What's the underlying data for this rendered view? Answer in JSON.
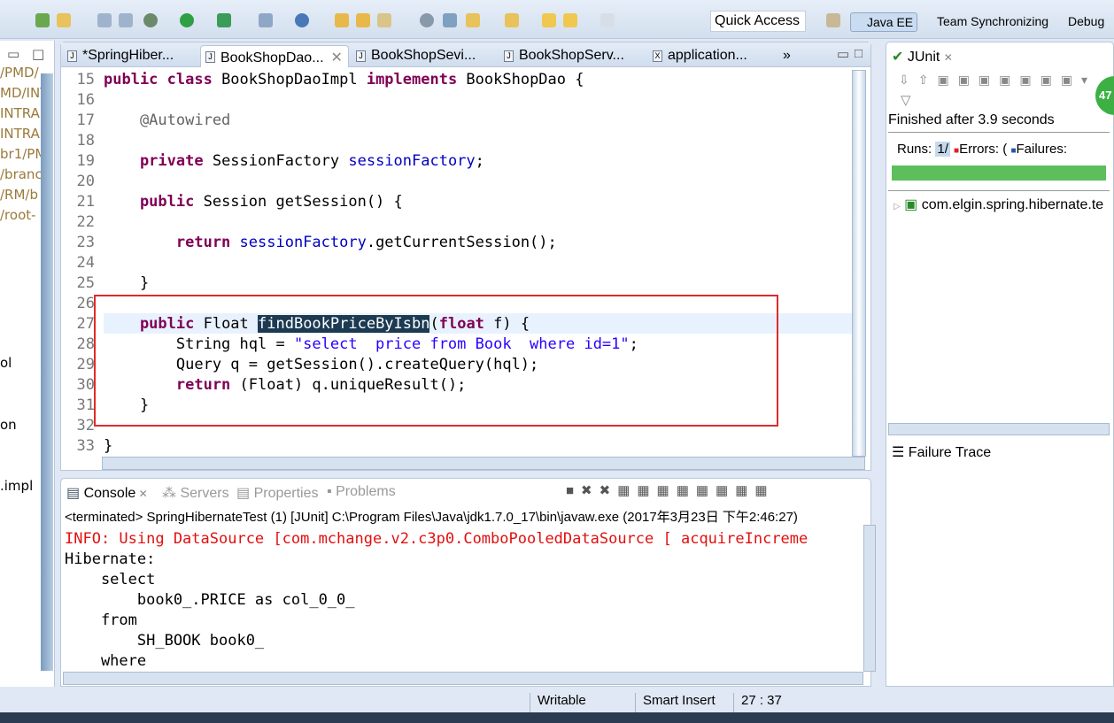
{
  "toolbar": {
    "quick_access": "Quick Access",
    "perspectives": [
      "Java EE",
      "Team Synchronizing",
      "Debug"
    ]
  },
  "left_panel": {
    "fragments": [
      "/PMD/",
      "MD/INT",
      "INTRA",
      "INTRA",
      "br1/PM",
      "/branc",
      "/RM/b",
      "/root-",
      "ol",
      "on",
      ".impl"
    ]
  },
  "editor": {
    "tabs": [
      {
        "label": "*SpringHiber..."
      },
      {
        "label": "BookShopDao...",
        "active": true
      },
      {
        "label": "BookShopSevi..."
      },
      {
        "label": "BookShopServ..."
      },
      {
        "label": "application..."
      }
    ],
    "overflow": "»",
    "lines": [
      {
        "n": "15",
        "t": [
          [
            "public class ",
            "kw"
          ],
          [
            "BookShopDaoImpl ",
            ""
          ],
          [
            "implements ",
            "kw"
          ],
          [
            "BookShopDao {",
            ""
          ]
        ]
      },
      {
        "n": "16",
        "t": []
      },
      {
        "n": "17",
        "t": [
          [
            "    @Autowired",
            "ann"
          ]
        ]
      },
      {
        "n": "18",
        "t": []
      },
      {
        "n": "19",
        "t": [
          [
            "    private ",
            "kw"
          ],
          [
            "SessionFactory ",
            ""
          ],
          [
            "sessionFactory",
            "fld"
          ],
          [
            ";",
            ""
          ]
        ]
      },
      {
        "n": "20",
        "t": []
      },
      {
        "n": "21",
        "t": [
          [
            "    public ",
            "kw"
          ],
          [
            "Session getSession() {",
            ""
          ]
        ]
      },
      {
        "n": "22",
        "t": []
      },
      {
        "n": "23",
        "t": [
          [
            "        return ",
            "kw"
          ],
          [
            "sessionFactory",
            "fld"
          ],
          [
            ".getCurrentSession();",
            ""
          ]
        ]
      },
      {
        "n": "24",
        "t": []
      },
      {
        "n": "25",
        "t": [
          [
            "    }",
            ""
          ]
        ]
      },
      {
        "n": "26",
        "t": []
      },
      {
        "n": "27",
        "t": [
          [
            "    public ",
            "kw"
          ],
          [
            "Float ",
            ""
          ],
          [
            "findBookPriceByIsbn",
            "sel"
          ],
          [
            "(",
            ""
          ],
          [
            "float ",
            "kw"
          ],
          [
            "f) {",
            ""
          ]
        ]
      },
      {
        "n": "28",
        "t": [
          [
            "        String hql = ",
            ""
          ],
          [
            "\"select  price from Book  where id=1\"",
            "str"
          ],
          [
            ";",
            ""
          ]
        ]
      },
      {
        "n": "29",
        "t": [
          [
            "        Query q = getSession().createQuery(hql);",
            ""
          ]
        ]
      },
      {
        "n": "30",
        "t": [
          [
            "        return ",
            "kw"
          ],
          [
            "(Float) q.uniqueResult();",
            ""
          ]
        ]
      },
      {
        "n": "31",
        "t": [
          [
            "    }",
            ""
          ]
        ]
      },
      {
        "n": "32",
        "t": []
      },
      {
        "n": "33",
        "t": [
          [
            "}",
            ""
          ]
        ]
      }
    ]
  },
  "console": {
    "tabs": [
      "Console",
      "Servers",
      "Properties",
      "Problems"
    ],
    "header": "<terminated> SpringHibernateTest (1) [JUnit] C:\\Program Files\\Java\\jdk1.7.0_17\\bin\\javaw.exe (2017年3月23日 下午2:46:27)",
    "lines": [
      {
        "text": "INFO: Using DataSource [com.mchange.v2.c3p0.ComboPooledDataSource [ acquireIncreme",
        "color": "#e01010"
      },
      {
        "text": "Hibernate:",
        "color": "#000000"
      },
      {
        "text": "    select",
        "color": "#000000"
      },
      {
        "text": "        book0_.PRICE as col_0_0_",
        "color": "#000000"
      },
      {
        "text": "    from",
        "color": "#000000"
      },
      {
        "text": "        SH_BOOK book0_",
        "color": "#000000"
      },
      {
        "text": "    where",
        "color": "#000000"
      }
    ]
  },
  "junit": {
    "tab": "JUnit",
    "finished": "Finished after 3.9 seconds",
    "runs_label": "Runs:",
    "runs_value": "1/",
    "errors_label": "Errors:",
    "errors_value": "(",
    "failures_label": "Failures:",
    "progress": 1.0,
    "progress_color": "#5cbf5c",
    "tree_item": "com.elgin.spring.hibernate.te",
    "failure_trace": "Failure Trace",
    "badge": "47"
  },
  "status": {
    "writable": "Writable",
    "insert_mode": "Smart Insert",
    "position": "27 : 37"
  }
}
